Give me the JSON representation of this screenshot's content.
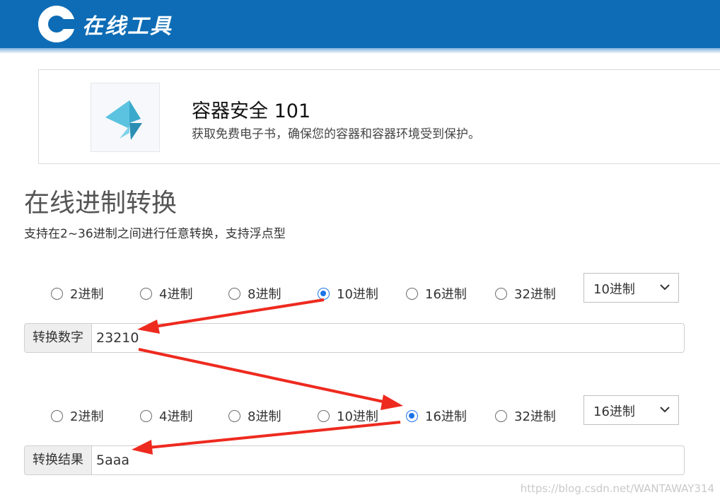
{
  "header": {
    "logo_letter": "C",
    "logo_text": "在线工具"
  },
  "ad": {
    "title": "容器安全 101",
    "description": "获取免费电子书，确保您的容器和容器环境受到保护。"
  },
  "page": {
    "heading": "在线进制转换",
    "subtitle": "支持在2~36进制之间进行任意转换，支持浮点型"
  },
  "input_section": {
    "radios": [
      {
        "label": "2进制",
        "checked": false
      },
      {
        "label": "4进制",
        "checked": false
      },
      {
        "label": "8进制",
        "checked": false
      },
      {
        "label": "10进制",
        "checked": true
      },
      {
        "label": "16进制",
        "checked": false
      },
      {
        "label": "32进制",
        "checked": false
      }
    ],
    "select_value": "10进制",
    "addon_label": "转换数字",
    "value": "23210"
  },
  "output_section": {
    "radios": [
      {
        "label": "2进制",
        "checked": false
      },
      {
        "label": "4进制",
        "checked": false
      },
      {
        "label": "8进制",
        "checked": false
      },
      {
        "label": "10进制",
        "checked": false
      },
      {
        "label": "16进制",
        "checked": true
      },
      {
        "label": "32进制",
        "checked": false
      }
    ],
    "select_value": "16进制",
    "addon_label": "转换结果",
    "value": "5aaa"
  },
  "annotation_color": "#ee2a1f",
  "brand_color": "#0d6cb5",
  "watermark": "https://blog.csdn.net/WANTAWAY314"
}
